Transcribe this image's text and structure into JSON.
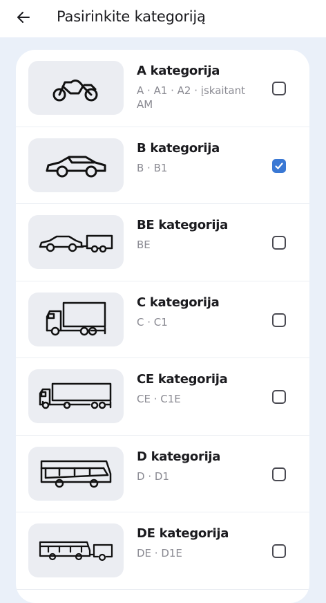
{
  "header": {
    "title": "Pasirinkite kategoriją",
    "back_icon": "arrow-left-icon"
  },
  "colors": {
    "accent": "#3a78d4",
    "background": "#eaf0f9",
    "card": "#ffffff",
    "thumb": "#ebedf2"
  },
  "categories": [
    {
      "name": "A kategorija",
      "sub": "A · A1 · A2 · įskaitant AM",
      "icon": "motorcycle-icon",
      "checked": false
    },
    {
      "name": "B kategorija",
      "sub": "B · B1",
      "icon": "car-icon",
      "checked": true
    },
    {
      "name": "BE kategorija",
      "sub": "BE",
      "icon": "car-trailer-icon",
      "checked": false
    },
    {
      "name": "C kategorija",
      "sub": "C · C1",
      "icon": "truck-icon",
      "checked": false
    },
    {
      "name": "CE kategorija",
      "sub": "CE · C1E",
      "icon": "truck-trailer-icon",
      "checked": false
    },
    {
      "name": "D kategorija",
      "sub": "D · D1",
      "icon": "bus-icon",
      "checked": false
    },
    {
      "name": "DE kategorija",
      "sub": "DE · D1E",
      "icon": "bus-trailer-icon",
      "checked": false
    }
  ]
}
